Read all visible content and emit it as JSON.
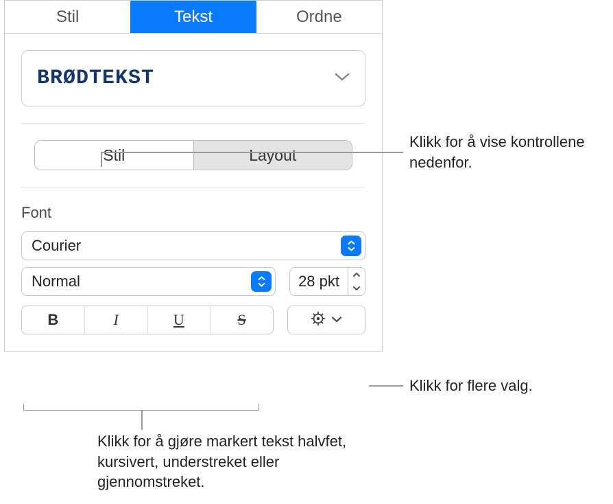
{
  "main_tabs": {
    "stil": "Stil",
    "tekst": "Tekst",
    "ordne": "Ordne"
  },
  "paragraph_style": {
    "label": "BRØDTEKST"
  },
  "sub_tabs": {
    "stil": "Stil",
    "layout": "Layout"
  },
  "font": {
    "section_label": "Font",
    "family": "Courier",
    "weight": "Normal",
    "size": "28 pkt",
    "bold_glyph": "B",
    "italic_glyph": "I",
    "underline_glyph": "U",
    "strike_glyph": "S"
  },
  "callouts": {
    "top": "Klikk for å vise kontrollene nedenfor.",
    "right": "Klikk for flere valg.",
    "bottom": "Klikk for å gjøre markert tekst halvfet, kursivert, understreket eller gjennomstreket."
  }
}
